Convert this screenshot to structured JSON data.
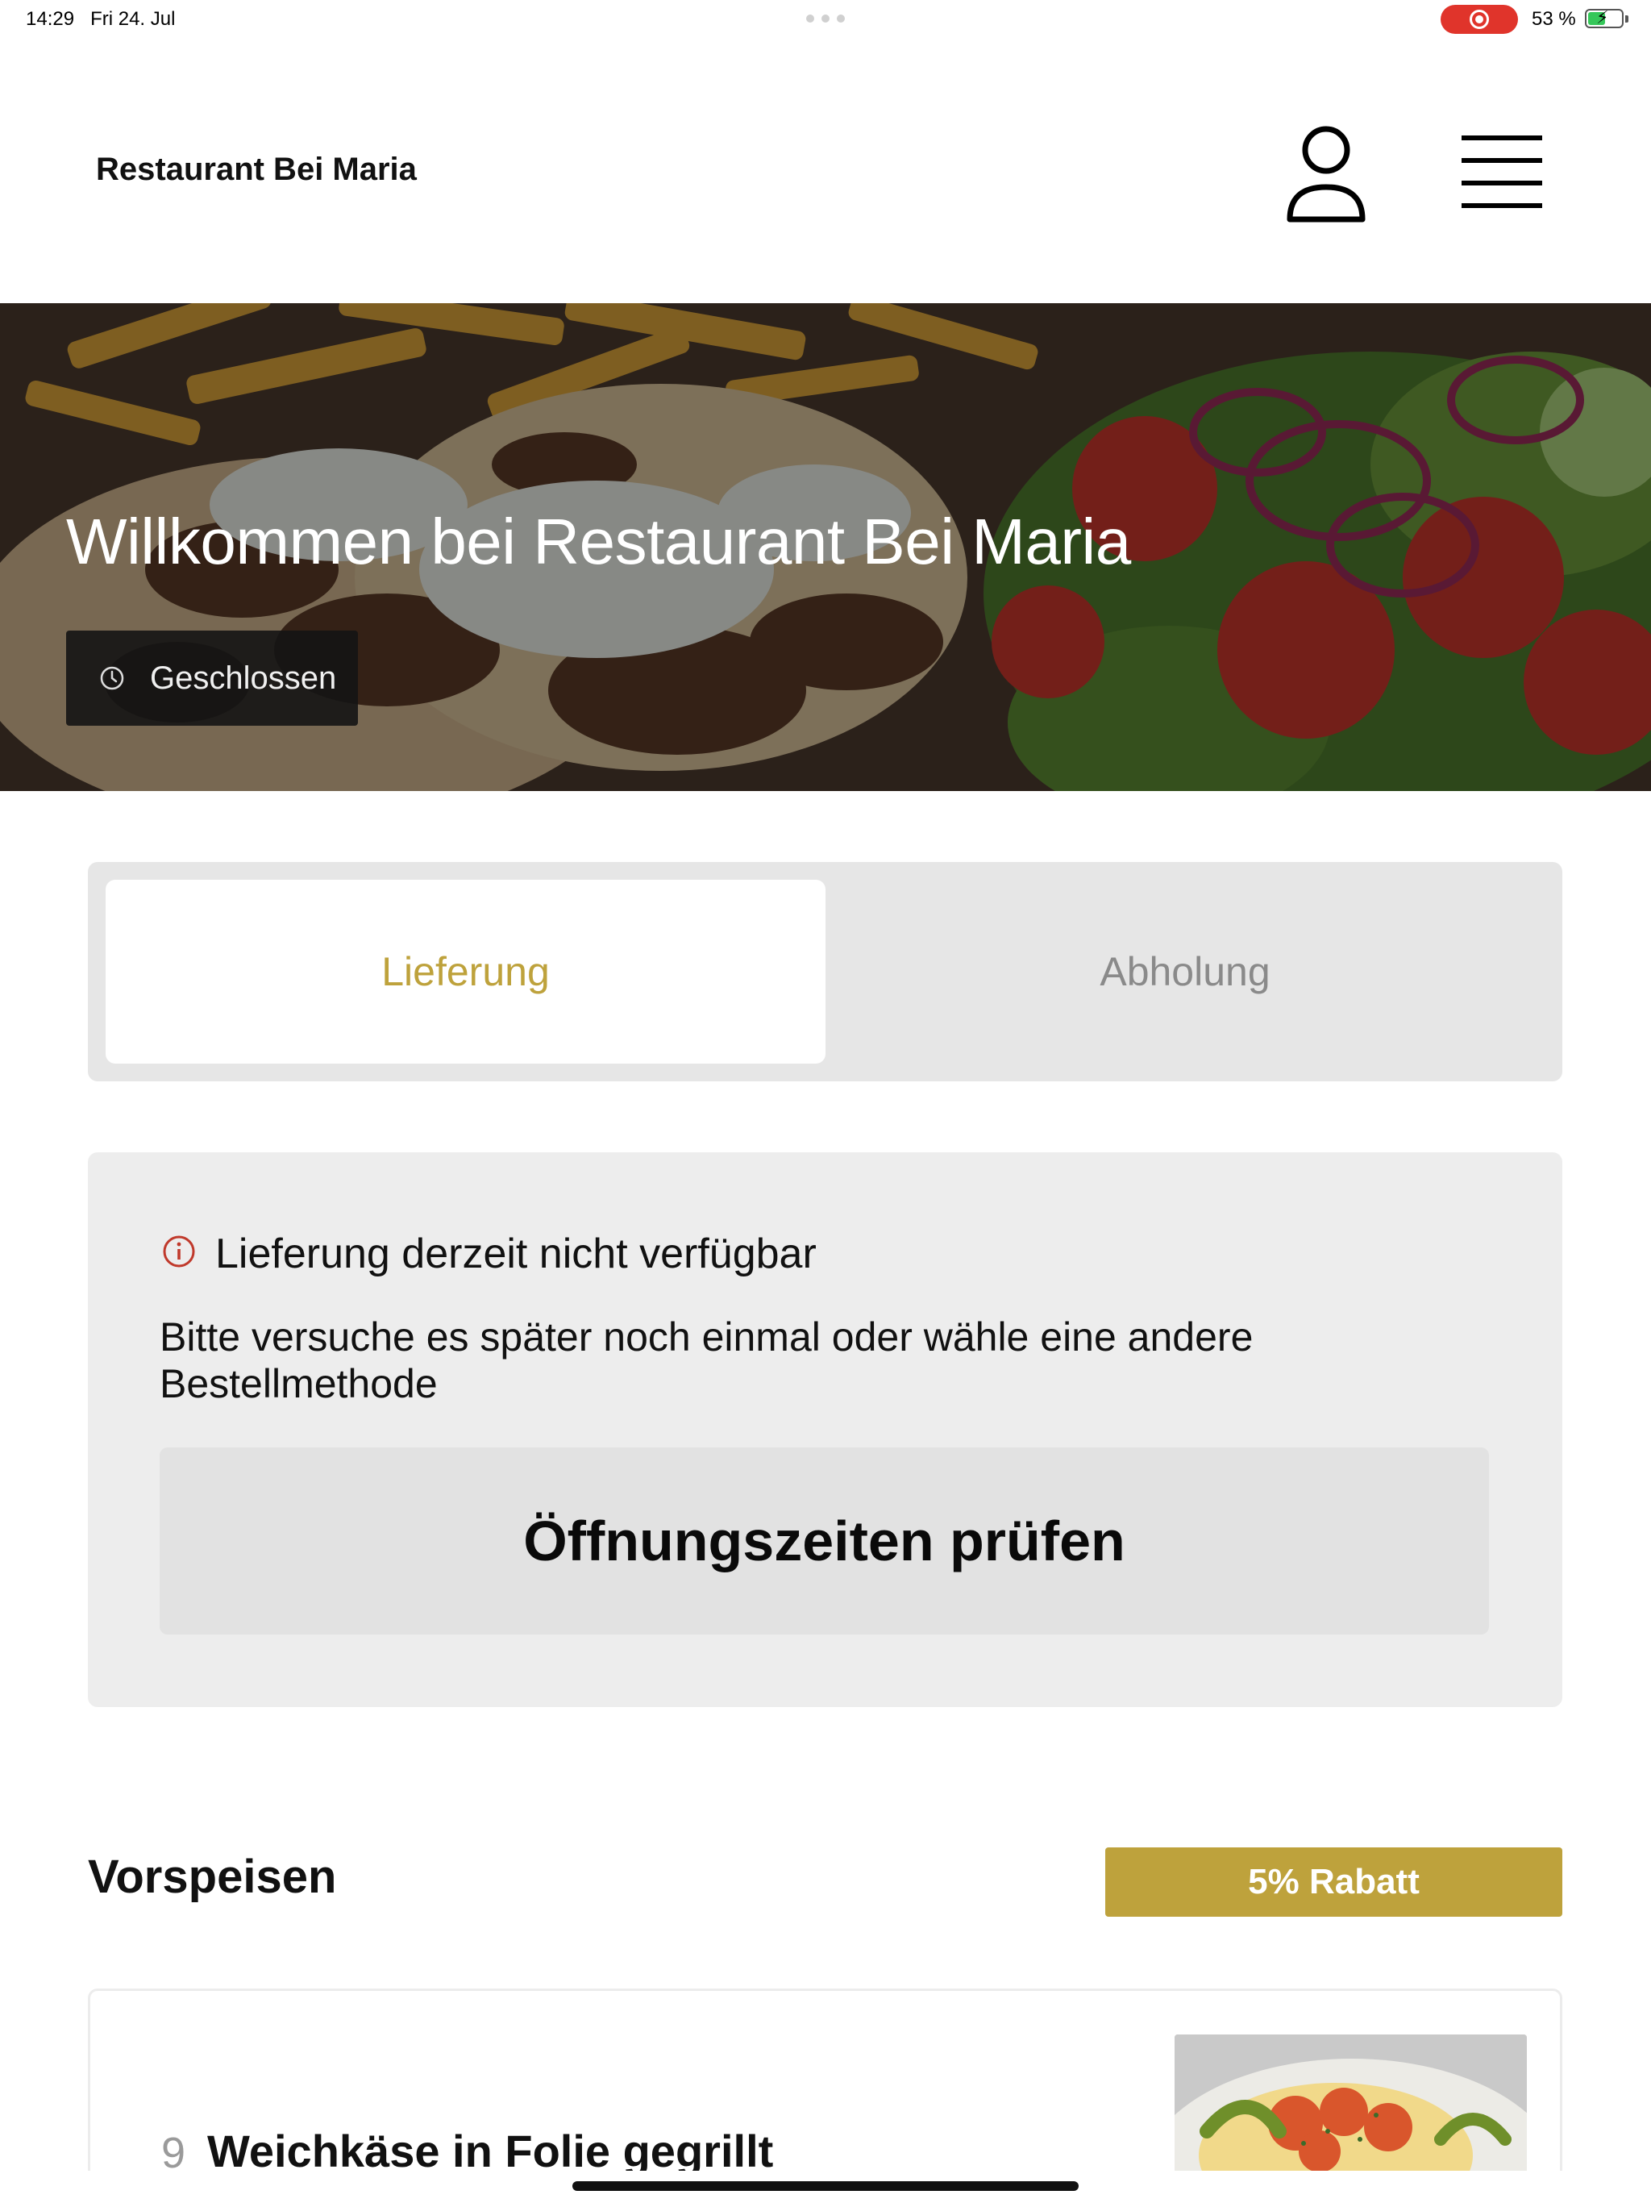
{
  "status_bar": {
    "time": "14:29",
    "date": "Fri 24. Jul",
    "battery_text": "53 %",
    "battery_level": 0.53,
    "recording": true,
    "icons": [
      "screen-recording-icon",
      "battery-charging-icon"
    ]
  },
  "header": {
    "brand": "Restaurant Bei Maria",
    "icons": [
      "user-icon",
      "hamburger-menu-icon"
    ]
  },
  "hero": {
    "title": "Willkommen bei Restaurant Bei Maria",
    "status_label": "Geschlossen",
    "status_icon": "clock-icon"
  },
  "order_tabs": {
    "selected": "delivery",
    "delivery_label": "Lieferung",
    "pickup_label": "Abholung"
  },
  "notice": {
    "icon": "info-icon",
    "title": "Lieferung derzeit nicht verfügbar",
    "text": "Bitte versuche es später noch einmal oder wähle eine andere Bestellmethode",
    "button_label": "Öffnungszeiten prüfen"
  },
  "section": {
    "title": "Vorspeisen",
    "badge": "5% Rabatt"
  },
  "items": [
    {
      "number": "9",
      "name": "Weichkäse in Folie gegrillt"
    }
  ],
  "colors": {
    "accent": "#bea23c",
    "tab_bg": "#e6e6e6",
    "notice_bg": "#ededed",
    "notice_icon": "#c0392b",
    "recording": "#e0342b"
  }
}
